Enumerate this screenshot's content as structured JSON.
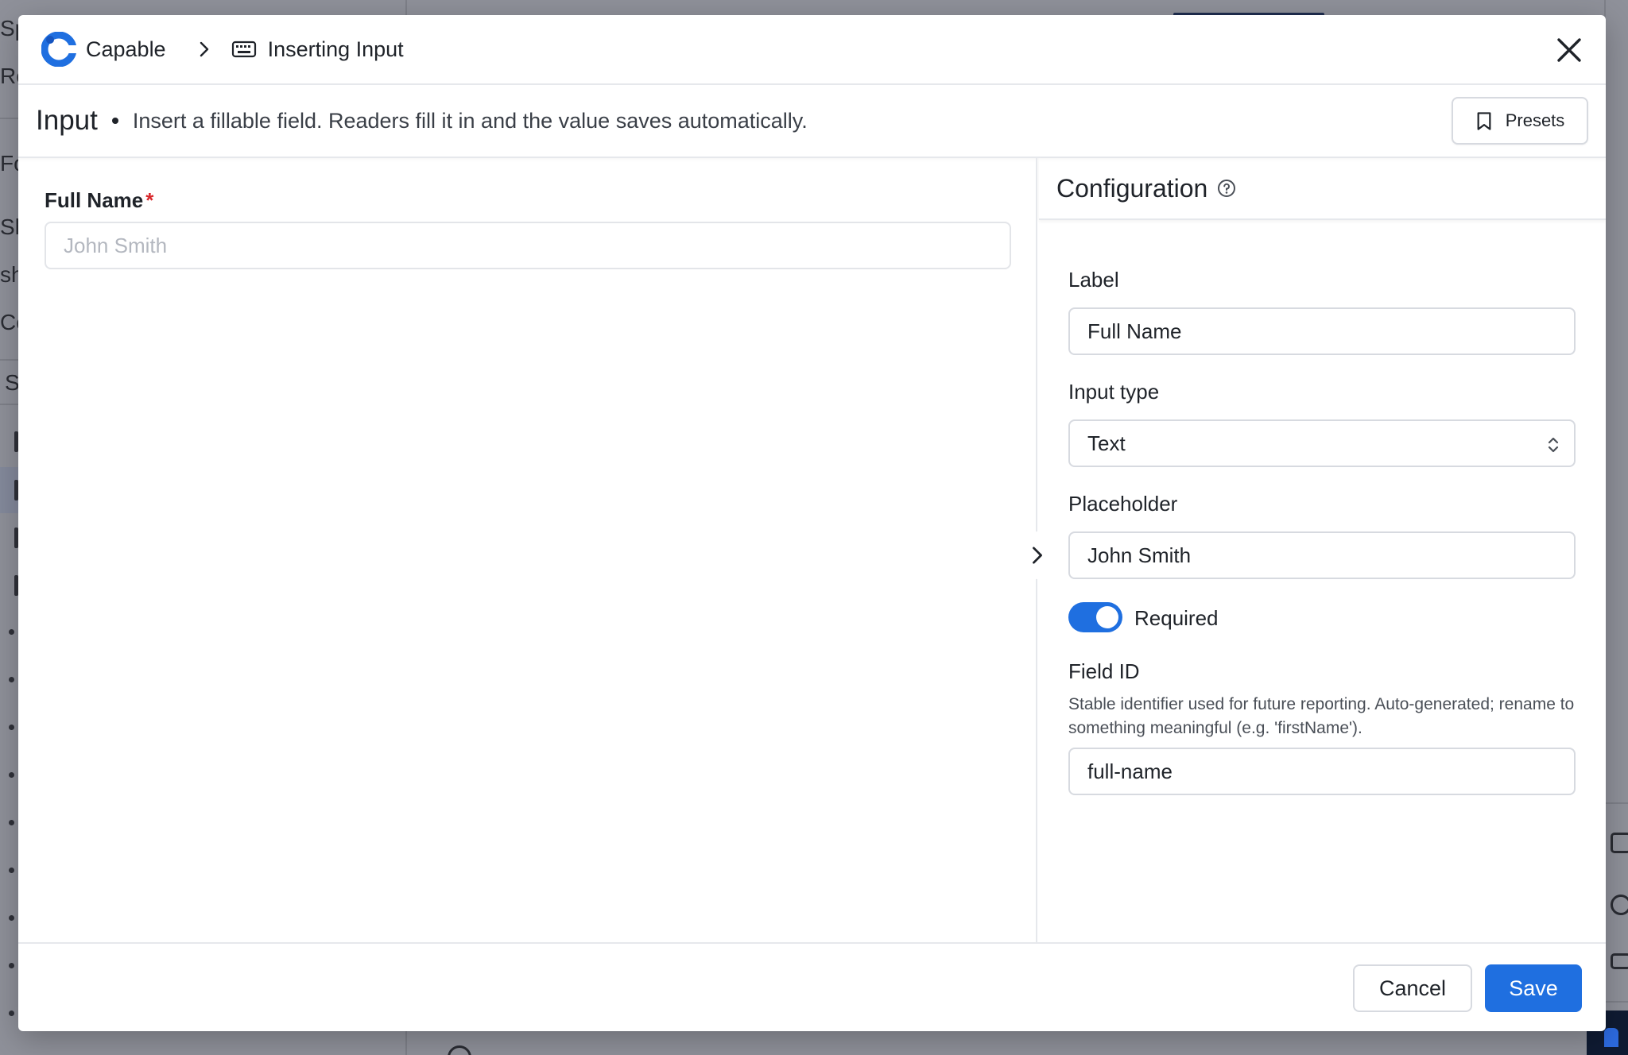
{
  "background": {
    "sidebar_fragments": [
      "Sp",
      "Re",
      "Fo",
      "Sh",
      "sh",
      "Co",
      "S"
    ]
  },
  "topbar": {
    "app_name": "Capable",
    "page_name": "Inserting Input"
  },
  "header": {
    "title": "Input",
    "description": "Insert a fillable field. Readers fill it in and the value saves automatically.",
    "presets_label": "Presets"
  },
  "preview": {
    "field_label": "Full Name",
    "required_mark": "*",
    "placeholder": "John Smith"
  },
  "config": {
    "title": "Configuration",
    "label_title": "Label",
    "label_value": "Full Name",
    "input_type_title": "Input type",
    "input_type_value": "Text",
    "placeholder_title": "Placeholder",
    "placeholder_value": "John Smith",
    "required_label": "Required",
    "required_on": true,
    "field_id_title": "Field ID",
    "field_id_help": "Stable identifier used for future reporting. Auto-generated; rename to something meaningful (e.g. 'firstName').",
    "field_id_value": "full-name"
  },
  "footer": {
    "cancel_label": "Cancel",
    "save_label": "Save"
  },
  "colors": {
    "accent": "#1f6fe0",
    "required": "#d9262a",
    "overlay": "#8f919a"
  }
}
